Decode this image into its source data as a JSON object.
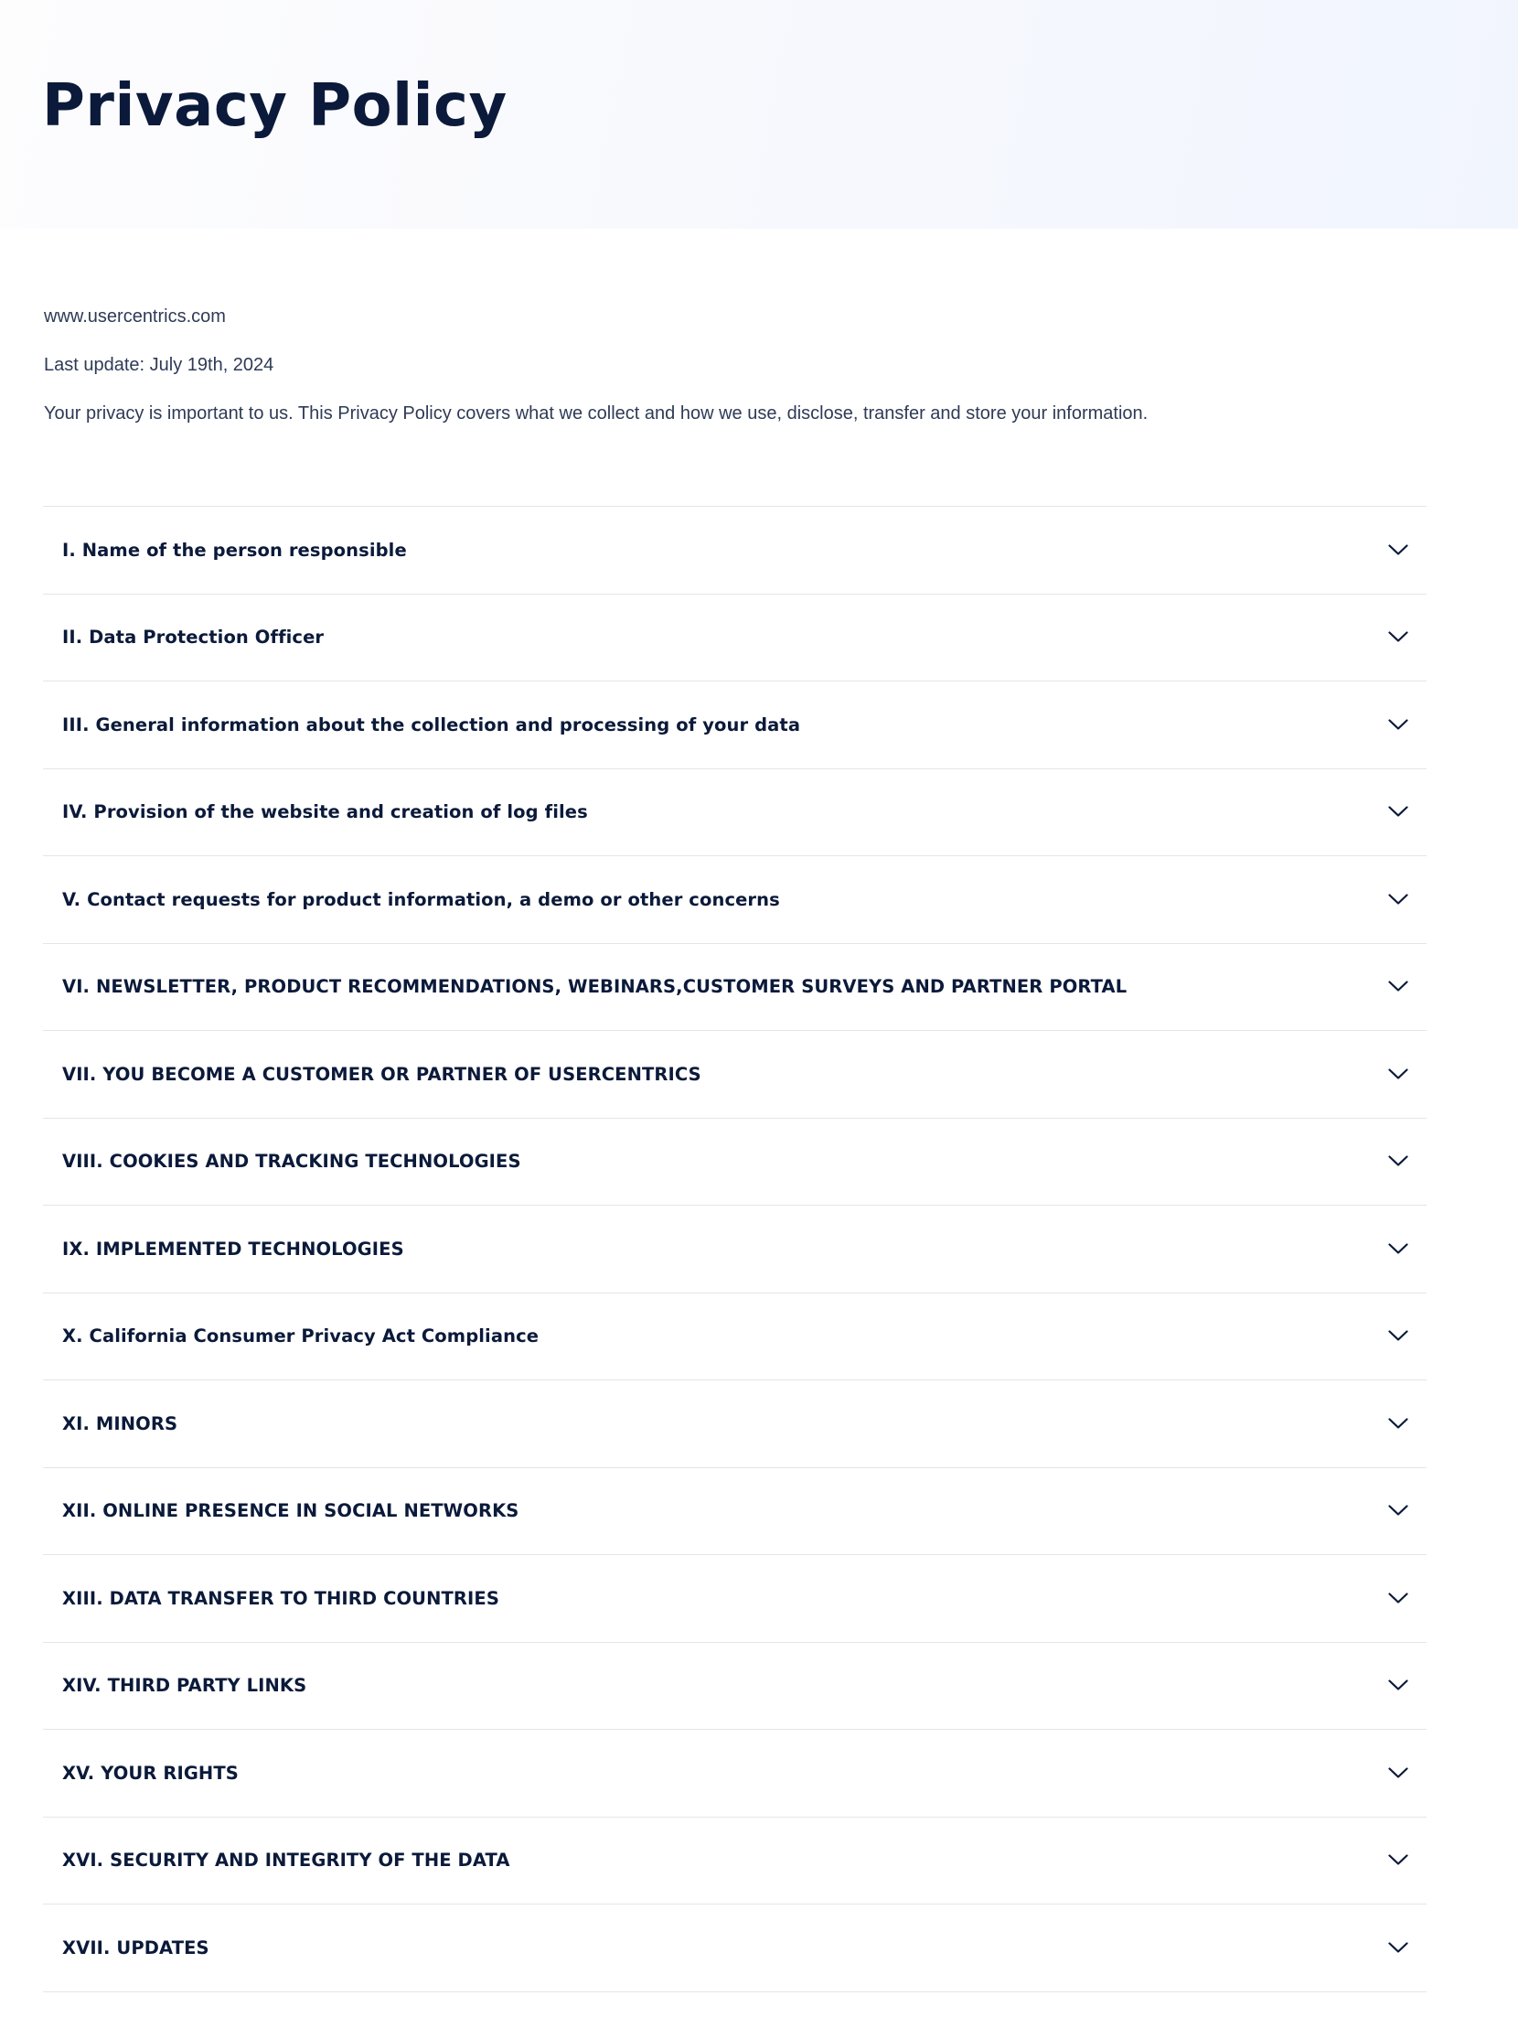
{
  "hero": {
    "title": "Privacy Policy"
  },
  "intro": {
    "website": "www.usercentrics.com",
    "last_update": "Last update: July 19th, 2024",
    "summary": "Your privacy is important to us. This Privacy Policy covers what we collect and how we use, disclose, transfer and store your information."
  },
  "accordion": {
    "expand_icon": "chevron-down-icon",
    "sections": [
      {
        "label": "I. Name of the person responsible"
      },
      {
        "label": "II. Data Protection Officer"
      },
      {
        "label": "III. General information about the collection and processing of your data"
      },
      {
        "label": "IV. Provision of the website and creation of log files"
      },
      {
        "label": "V. Contact requests for product information, a demo or other concerns"
      },
      {
        "label": "VI. NEWSLETTER, PRODUCT RECOMMENDATIONS, WEBINARS,CUSTOMER SURVEYS AND PARTNER PORTAL"
      },
      {
        "label": "VII. YOU BECOME A CUSTOMER OR PARTNER OF USERCENTRICS"
      },
      {
        "label": "VIII. COOKIES AND TRACKING TECHNOLOGIES"
      },
      {
        "label": "IX. IMPLEMENTED TECHNOLOGIES"
      },
      {
        "label": "X. California Consumer Privacy Act Compliance"
      },
      {
        "label": "XI. MINORS"
      },
      {
        "label": "XII. ONLINE PRESENCE IN SOCIAL NETWORKS"
      },
      {
        "label": "XIII. DATA TRANSFER TO THIRD COUNTRIES"
      },
      {
        "label": "XIV. THIRD PARTY LINKS"
      },
      {
        "label": "XV. YOUR RIGHTS"
      },
      {
        "label": "XVI. SECURITY AND INTEGRITY OF THE DATA"
      },
      {
        "label": "XVII. UPDATES"
      }
    ]
  },
  "colors": {
    "heading": "#0b1a3a",
    "body_text": "#2e3a56",
    "divider": "#e3e5ea",
    "hero_gradient_end": "#f1f5fe"
  }
}
